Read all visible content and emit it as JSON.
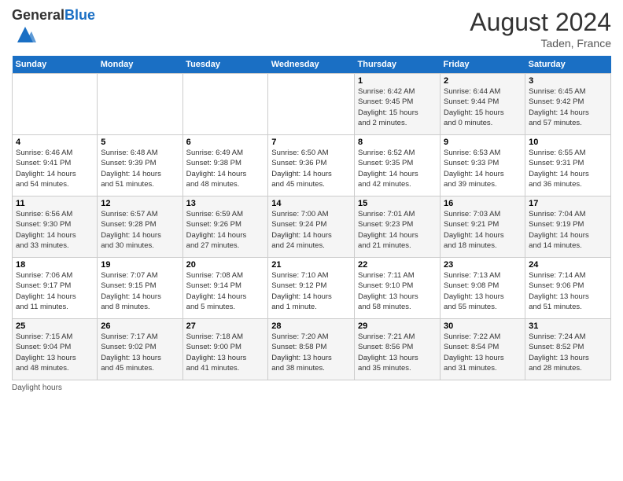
{
  "header": {
    "logo_general": "General",
    "logo_blue": "Blue",
    "month_year": "August 2024",
    "location": "Taden, France"
  },
  "footer": {
    "note": "Daylight hours"
  },
  "weekdays": [
    "Sunday",
    "Monday",
    "Tuesday",
    "Wednesday",
    "Thursday",
    "Friday",
    "Saturday"
  ],
  "weeks": [
    [
      {
        "day": "",
        "info": ""
      },
      {
        "day": "",
        "info": ""
      },
      {
        "day": "",
        "info": ""
      },
      {
        "day": "",
        "info": ""
      },
      {
        "day": "1",
        "info": "Sunrise: 6:42 AM\nSunset: 9:45 PM\nDaylight: 15 hours\nand 2 minutes."
      },
      {
        "day": "2",
        "info": "Sunrise: 6:44 AM\nSunset: 9:44 PM\nDaylight: 15 hours\nand 0 minutes."
      },
      {
        "day": "3",
        "info": "Sunrise: 6:45 AM\nSunset: 9:42 PM\nDaylight: 14 hours\nand 57 minutes."
      }
    ],
    [
      {
        "day": "4",
        "info": "Sunrise: 6:46 AM\nSunset: 9:41 PM\nDaylight: 14 hours\nand 54 minutes."
      },
      {
        "day": "5",
        "info": "Sunrise: 6:48 AM\nSunset: 9:39 PM\nDaylight: 14 hours\nand 51 minutes."
      },
      {
        "day": "6",
        "info": "Sunrise: 6:49 AM\nSunset: 9:38 PM\nDaylight: 14 hours\nand 48 minutes."
      },
      {
        "day": "7",
        "info": "Sunrise: 6:50 AM\nSunset: 9:36 PM\nDaylight: 14 hours\nand 45 minutes."
      },
      {
        "day": "8",
        "info": "Sunrise: 6:52 AM\nSunset: 9:35 PM\nDaylight: 14 hours\nand 42 minutes."
      },
      {
        "day": "9",
        "info": "Sunrise: 6:53 AM\nSunset: 9:33 PM\nDaylight: 14 hours\nand 39 minutes."
      },
      {
        "day": "10",
        "info": "Sunrise: 6:55 AM\nSunset: 9:31 PM\nDaylight: 14 hours\nand 36 minutes."
      }
    ],
    [
      {
        "day": "11",
        "info": "Sunrise: 6:56 AM\nSunset: 9:30 PM\nDaylight: 14 hours\nand 33 minutes."
      },
      {
        "day": "12",
        "info": "Sunrise: 6:57 AM\nSunset: 9:28 PM\nDaylight: 14 hours\nand 30 minutes."
      },
      {
        "day": "13",
        "info": "Sunrise: 6:59 AM\nSunset: 9:26 PM\nDaylight: 14 hours\nand 27 minutes."
      },
      {
        "day": "14",
        "info": "Sunrise: 7:00 AM\nSunset: 9:24 PM\nDaylight: 14 hours\nand 24 minutes."
      },
      {
        "day": "15",
        "info": "Sunrise: 7:01 AM\nSunset: 9:23 PM\nDaylight: 14 hours\nand 21 minutes."
      },
      {
        "day": "16",
        "info": "Sunrise: 7:03 AM\nSunset: 9:21 PM\nDaylight: 14 hours\nand 18 minutes."
      },
      {
        "day": "17",
        "info": "Sunrise: 7:04 AM\nSunset: 9:19 PM\nDaylight: 14 hours\nand 14 minutes."
      }
    ],
    [
      {
        "day": "18",
        "info": "Sunrise: 7:06 AM\nSunset: 9:17 PM\nDaylight: 14 hours\nand 11 minutes."
      },
      {
        "day": "19",
        "info": "Sunrise: 7:07 AM\nSunset: 9:15 PM\nDaylight: 14 hours\nand 8 minutes."
      },
      {
        "day": "20",
        "info": "Sunrise: 7:08 AM\nSunset: 9:14 PM\nDaylight: 14 hours\nand 5 minutes."
      },
      {
        "day": "21",
        "info": "Sunrise: 7:10 AM\nSunset: 9:12 PM\nDaylight: 14 hours\nand 1 minute."
      },
      {
        "day": "22",
        "info": "Sunrise: 7:11 AM\nSunset: 9:10 PM\nDaylight: 13 hours\nand 58 minutes."
      },
      {
        "day": "23",
        "info": "Sunrise: 7:13 AM\nSunset: 9:08 PM\nDaylight: 13 hours\nand 55 minutes."
      },
      {
        "day": "24",
        "info": "Sunrise: 7:14 AM\nSunset: 9:06 PM\nDaylight: 13 hours\nand 51 minutes."
      }
    ],
    [
      {
        "day": "25",
        "info": "Sunrise: 7:15 AM\nSunset: 9:04 PM\nDaylight: 13 hours\nand 48 minutes."
      },
      {
        "day": "26",
        "info": "Sunrise: 7:17 AM\nSunset: 9:02 PM\nDaylight: 13 hours\nand 45 minutes."
      },
      {
        "day": "27",
        "info": "Sunrise: 7:18 AM\nSunset: 9:00 PM\nDaylight: 13 hours\nand 41 minutes."
      },
      {
        "day": "28",
        "info": "Sunrise: 7:20 AM\nSunset: 8:58 PM\nDaylight: 13 hours\nand 38 minutes."
      },
      {
        "day": "29",
        "info": "Sunrise: 7:21 AM\nSunset: 8:56 PM\nDaylight: 13 hours\nand 35 minutes."
      },
      {
        "day": "30",
        "info": "Sunrise: 7:22 AM\nSunset: 8:54 PM\nDaylight: 13 hours\nand 31 minutes."
      },
      {
        "day": "31",
        "info": "Sunrise: 7:24 AM\nSunset: 8:52 PM\nDaylight: 13 hours\nand 28 minutes."
      }
    ]
  ]
}
